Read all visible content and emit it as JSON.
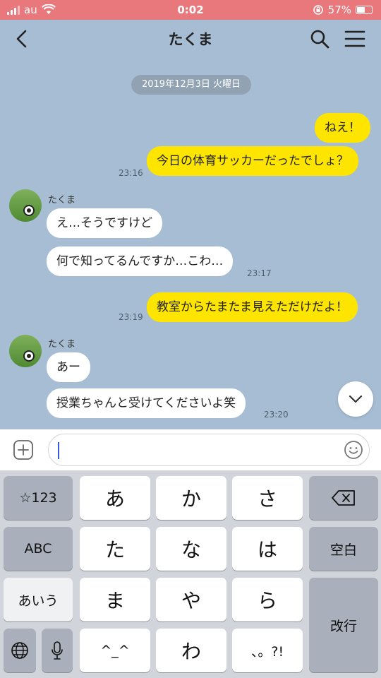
{
  "status_bar": {
    "carrier": "au",
    "time": "0:02",
    "battery": "57%",
    "battery_level": 0.57
  },
  "header": {
    "title": "たくま",
    "back_icon": "chevron-left-icon",
    "search_icon": "search-icon",
    "menu_icon": "hamburger-menu-icon"
  },
  "chat": {
    "date_chip": "2019年12月3日 火曜日",
    "messages": [
      {
        "from": "me",
        "text": "ねえ！"
      },
      {
        "from": "me",
        "text": "今日の体育サッカーだったでしょ？",
        "time": "23:16"
      },
      {
        "from": "them",
        "sender": "たくま",
        "text": "え…そうですけど"
      },
      {
        "from": "them",
        "text": "何で知ってるんですか…こわ…",
        "time": "23:17"
      },
      {
        "from": "me",
        "text": "教室からたまたま見えただけだよ！",
        "time": "23:19"
      },
      {
        "from": "them",
        "sender": "たくま",
        "text": "あー"
      },
      {
        "from": "them",
        "text": "授業ちゃんと受けてくださいよ笑",
        "time": "23:20"
      }
    ]
  },
  "input": {
    "value": "",
    "plus_icon": "plus-icon",
    "emoji_icon": "smiley-icon"
  },
  "keyboard": {
    "row1": [
      "☆123",
      "あ",
      "か",
      "さ",
      "delete"
    ],
    "row2": [
      "ABC",
      "た",
      "な",
      "は",
      "空白"
    ],
    "row3": [
      "あいう",
      "ま",
      "や",
      "ら",
      "改行"
    ],
    "row4": [
      "globe",
      "mic",
      "^_^",
      "わ",
      "、。?!"
    ],
    "accent_colors": {
      "my_bubble": "#fee500",
      "background": "#a7bdd3",
      "status_bar": "#e9787d"
    }
  }
}
